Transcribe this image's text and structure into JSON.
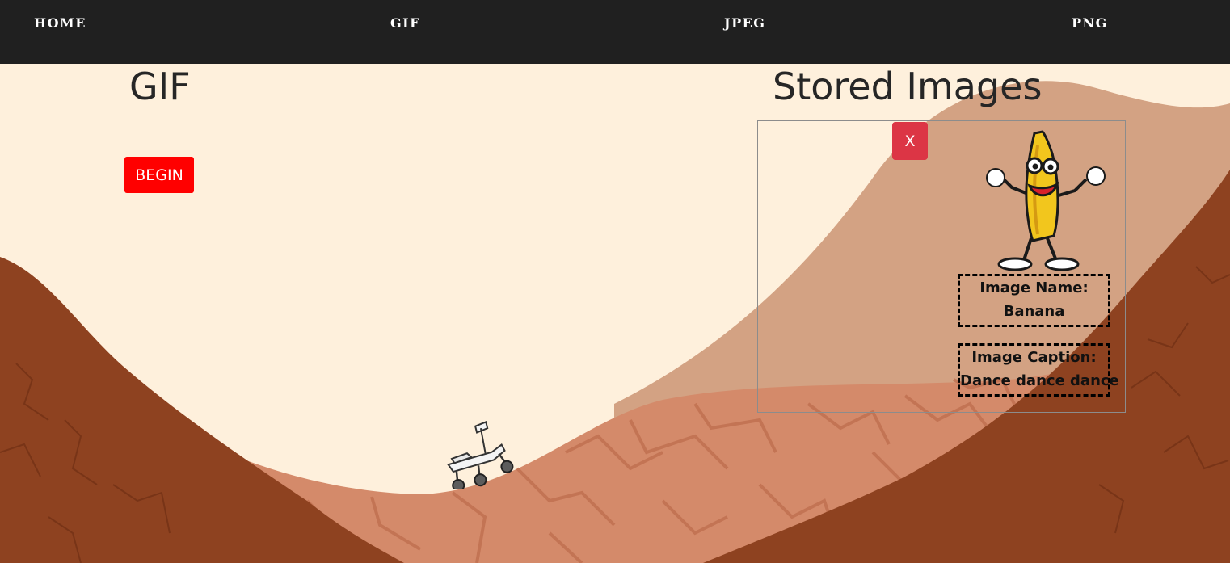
{
  "nav": {
    "home": "HOME",
    "gif": "GIF",
    "jpeg": "JPEG",
    "png": "PNG"
  },
  "main": {
    "heading": "GIF",
    "begin_label": "BEGIN"
  },
  "stored": {
    "heading": "Stored Images",
    "close_label": "X",
    "items": [
      {
        "name_label": "Image Name:",
        "name": "Banana",
        "caption_label": "Image Caption:",
        "caption": "Dance dance dance"
      }
    ]
  },
  "colors": {
    "navbar": "#202020",
    "background": "#fef0dc",
    "begin_button": "#ff0000",
    "close_button": "#dc3545",
    "terrain_dark": "#8e4220",
    "terrain_mid": "#d48a6a",
    "terrain_sand": "#d3a283"
  },
  "icons": {
    "banana": "dancing-banana-icon",
    "rover": "mars-rover-icon"
  }
}
